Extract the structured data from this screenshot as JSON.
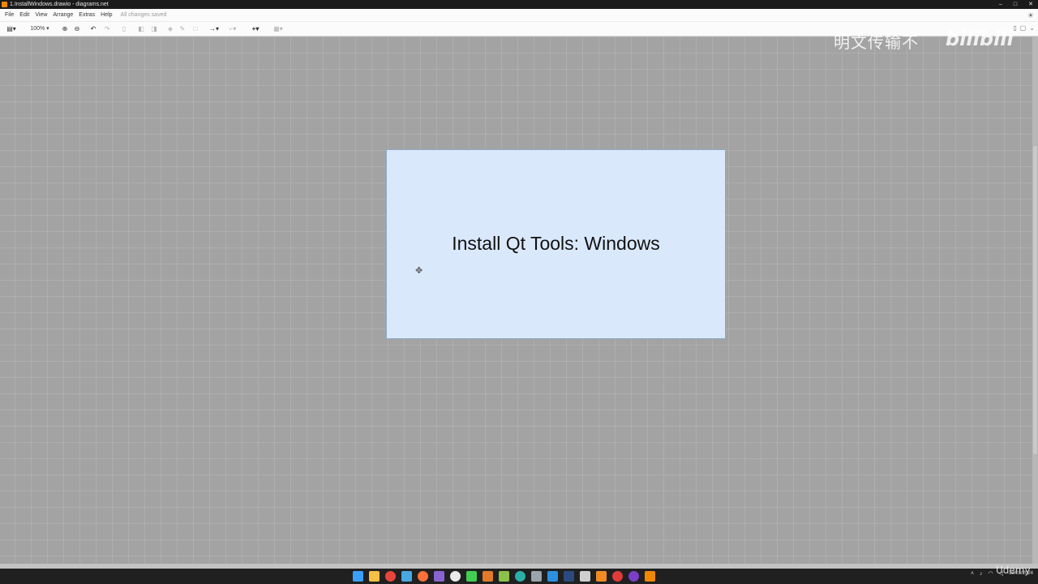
{
  "window": {
    "title": "1.InstallWindows.drawio - diagrams.net",
    "controls": [
      "–",
      "□",
      "✕"
    ]
  },
  "menubar": {
    "items": [
      "File",
      "Edit",
      "View",
      "Arrange",
      "Extras",
      "Help"
    ],
    "status": "All changes saved"
  },
  "toolbar": {
    "zoom": "100%"
  },
  "canvas": {
    "shape_label": "Install Qt Tools: Windows",
    "shape_fill": "#dae8fc",
    "shape_stroke": "#8ea9c7"
  },
  "watermark": {
    "text": "明文传输不",
    "logo": "bilibili"
  },
  "overlay": {
    "brand": "Udemy"
  },
  "taskbar": {
    "date": "19/03/2024"
  }
}
